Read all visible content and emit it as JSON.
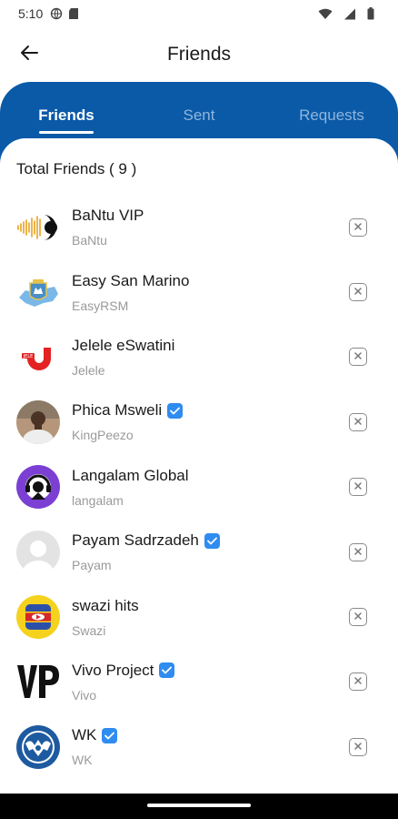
{
  "status_bar": {
    "time": "5:10"
  },
  "app_bar": {
    "title": "Friends"
  },
  "tabs": [
    {
      "label": "Friends",
      "active": true
    },
    {
      "label": "Sent",
      "active": false
    },
    {
      "label": "Requests",
      "active": false
    }
  ],
  "total_label": "Total Friends ( 9 )",
  "friends": [
    {
      "name": "BaNtu VIP",
      "username": "BaNtu",
      "verified": false,
      "avatar": "bantu-logo"
    },
    {
      "name": "Easy San Marino",
      "username": "EasyRSM",
      "verified": false,
      "avatar": "san-marino-map"
    },
    {
      "name": "Jelele eSwatini",
      "username": "Jelele",
      "verified": false,
      "avatar": "jelele-logo"
    },
    {
      "name": "Phica Msweli",
      "username": "KingPeezo",
      "verified": true,
      "avatar": "person-photo"
    },
    {
      "name": "Langalam Global",
      "username": "langalam",
      "verified": false,
      "avatar": "langalam-logo"
    },
    {
      "name": "Payam Sadrzadeh",
      "username": "Payam",
      "verified": true,
      "avatar": "default-person"
    },
    {
      "name": "swazi hits",
      "username": "Swazi",
      "verified": false,
      "avatar": "swazi-hits-logo"
    },
    {
      "name": "Vivo Project",
      "username": "Vivo",
      "verified": true,
      "avatar": "vp-logo"
    },
    {
      "name": "WK",
      "username": "WK",
      "verified": true,
      "avatar": "wk-emblem"
    }
  ],
  "colors": {
    "accent": "#0a5aa8",
    "verified": "#2f8cf0",
    "secondary_text": "#9a9a9a"
  }
}
